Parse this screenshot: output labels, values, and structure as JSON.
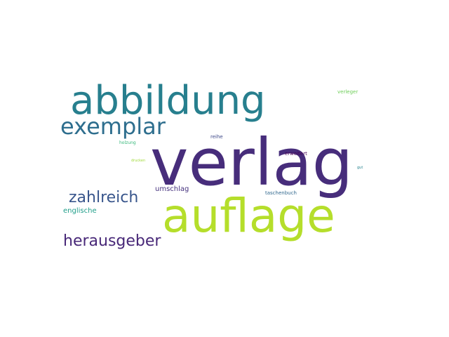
{
  "word_cloud": {
    "background": "#ffffff",
    "words": [
      {
        "key": "verlag",
        "text": "verlag",
        "color": "#472d7b"
      },
      {
        "key": "auflage",
        "text": "auflage",
        "color": "#b5de2b"
      },
      {
        "key": "abbildung",
        "text": "abbildung",
        "color": "#277f8e"
      },
      {
        "key": "exemplar",
        "text": "exemplar",
        "color": "#2e6e8e"
      },
      {
        "key": "zahlreich",
        "text": "zahlreich",
        "color": "#39568c"
      },
      {
        "key": "herausgeber",
        "text": "herausgeber",
        "color": "#482878"
      },
      {
        "key": "umschlag",
        "text": "umschlag",
        "color": "#46327e"
      },
      {
        "key": "englische",
        "text": "englische",
        "color": "#1f9e89"
      },
      {
        "key": "reihe",
        "text": "reihe",
        "color": "#3e4989"
      },
      {
        "key": "erweitert",
        "text": "erweitert",
        "color": "#440154"
      },
      {
        "key": "taschenbuch",
        "text": "taschenbuch",
        "color": "#31688e"
      },
      {
        "key": "verleger",
        "text": "verleger",
        "color": "#6ece58"
      },
      {
        "key": "holzung",
        "text": "holzung",
        "color": "#35b779"
      },
      {
        "key": "drucken",
        "text": "drucken",
        "color": "#a0da39"
      },
      {
        "key": "gut",
        "text": "gut",
        "color": "#26828e"
      }
    ]
  }
}
